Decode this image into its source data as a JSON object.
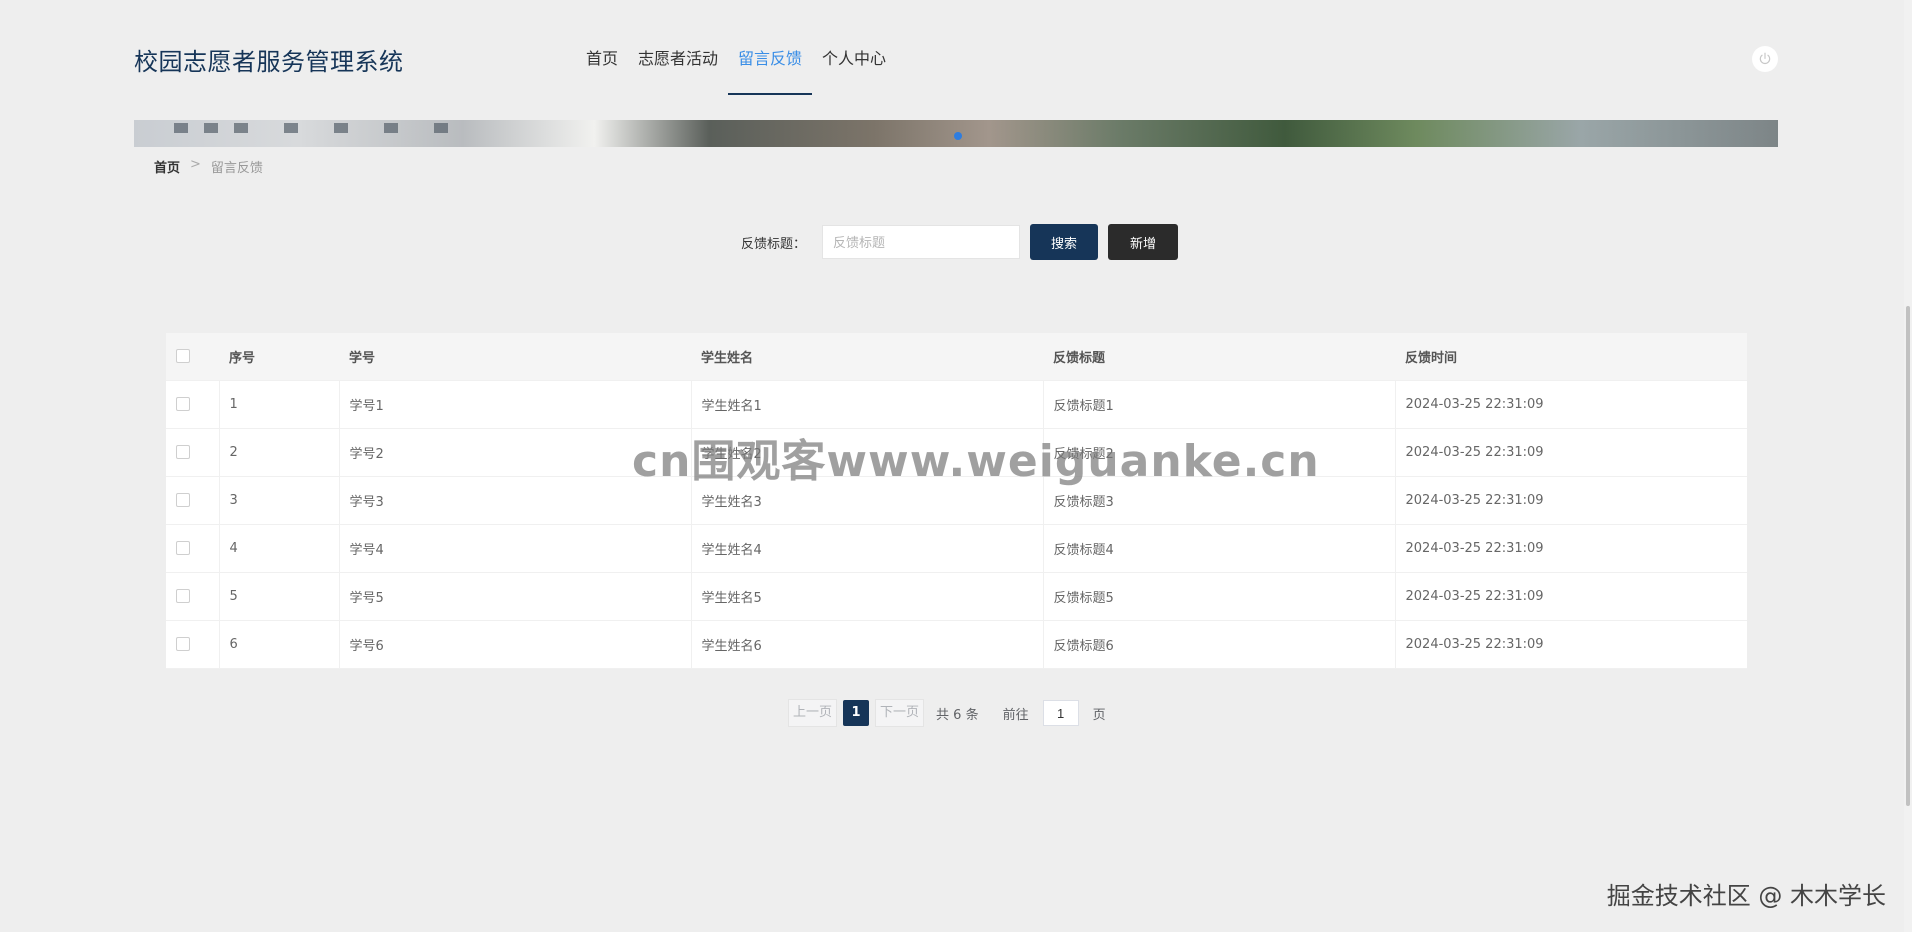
{
  "header": {
    "app_title": "校园志愿者服务管理系统",
    "nav": [
      {
        "label": "首页"
      },
      {
        "label": "志愿者活动"
      },
      {
        "label": "留言反馈"
      },
      {
        "label": "个人中心"
      }
    ],
    "active_nav": "留言反馈",
    "power_icon": "power-icon"
  },
  "breadcrumb": {
    "home": "首页",
    "separator": ">",
    "current": "留言反馈"
  },
  "search": {
    "label": "反馈标题：",
    "placeholder": "反馈标题",
    "value": "",
    "search_button": "搜索",
    "add_button": "新增"
  },
  "table": {
    "headers": [
      "序号",
      "学号",
      "学生姓名",
      "反馈标题",
      "反馈时间"
    ],
    "rows": [
      {
        "index": "1",
        "student_id": "学号1",
        "student_name": "学生姓名1",
        "title": "反馈标题1",
        "time": "2024-03-25 22:31:09"
      },
      {
        "index": "2",
        "student_id": "学号2",
        "student_name": "学生姓名2",
        "title": "反馈标题2",
        "time": "2024-03-25 22:31:09"
      },
      {
        "index": "3",
        "student_id": "学号3",
        "student_name": "学生姓名3",
        "title": "反馈标题3",
        "time": "2024-03-25 22:31:09"
      },
      {
        "index": "4",
        "student_id": "学号4",
        "student_name": "学生姓名4",
        "title": "反馈标题4",
        "time": "2024-03-25 22:31:09"
      },
      {
        "index": "5",
        "student_id": "学号5",
        "student_name": "学生姓名5",
        "title": "反馈标题5",
        "time": "2024-03-25 22:31:09"
      },
      {
        "index": "6",
        "student_id": "学号6",
        "student_name": "学生姓名6",
        "title": "反馈标题6",
        "time": "2024-03-25 22:31:09"
      }
    ]
  },
  "pagination": {
    "prev": "上一页",
    "current_page": "1",
    "next": "下一页",
    "total": "共 6 条",
    "goto_label": "前往",
    "goto_value": "1",
    "page_suffix": "页"
  },
  "watermarks": {
    "center": "cn围观客www.weiguanke.cn",
    "corner": "掘金技术社区 @ 木木学长"
  },
  "colors": {
    "primary": "#163558",
    "accent": "#3a8ee6",
    "dark_button": "#2b2b2b",
    "background": "#eeeeee"
  }
}
